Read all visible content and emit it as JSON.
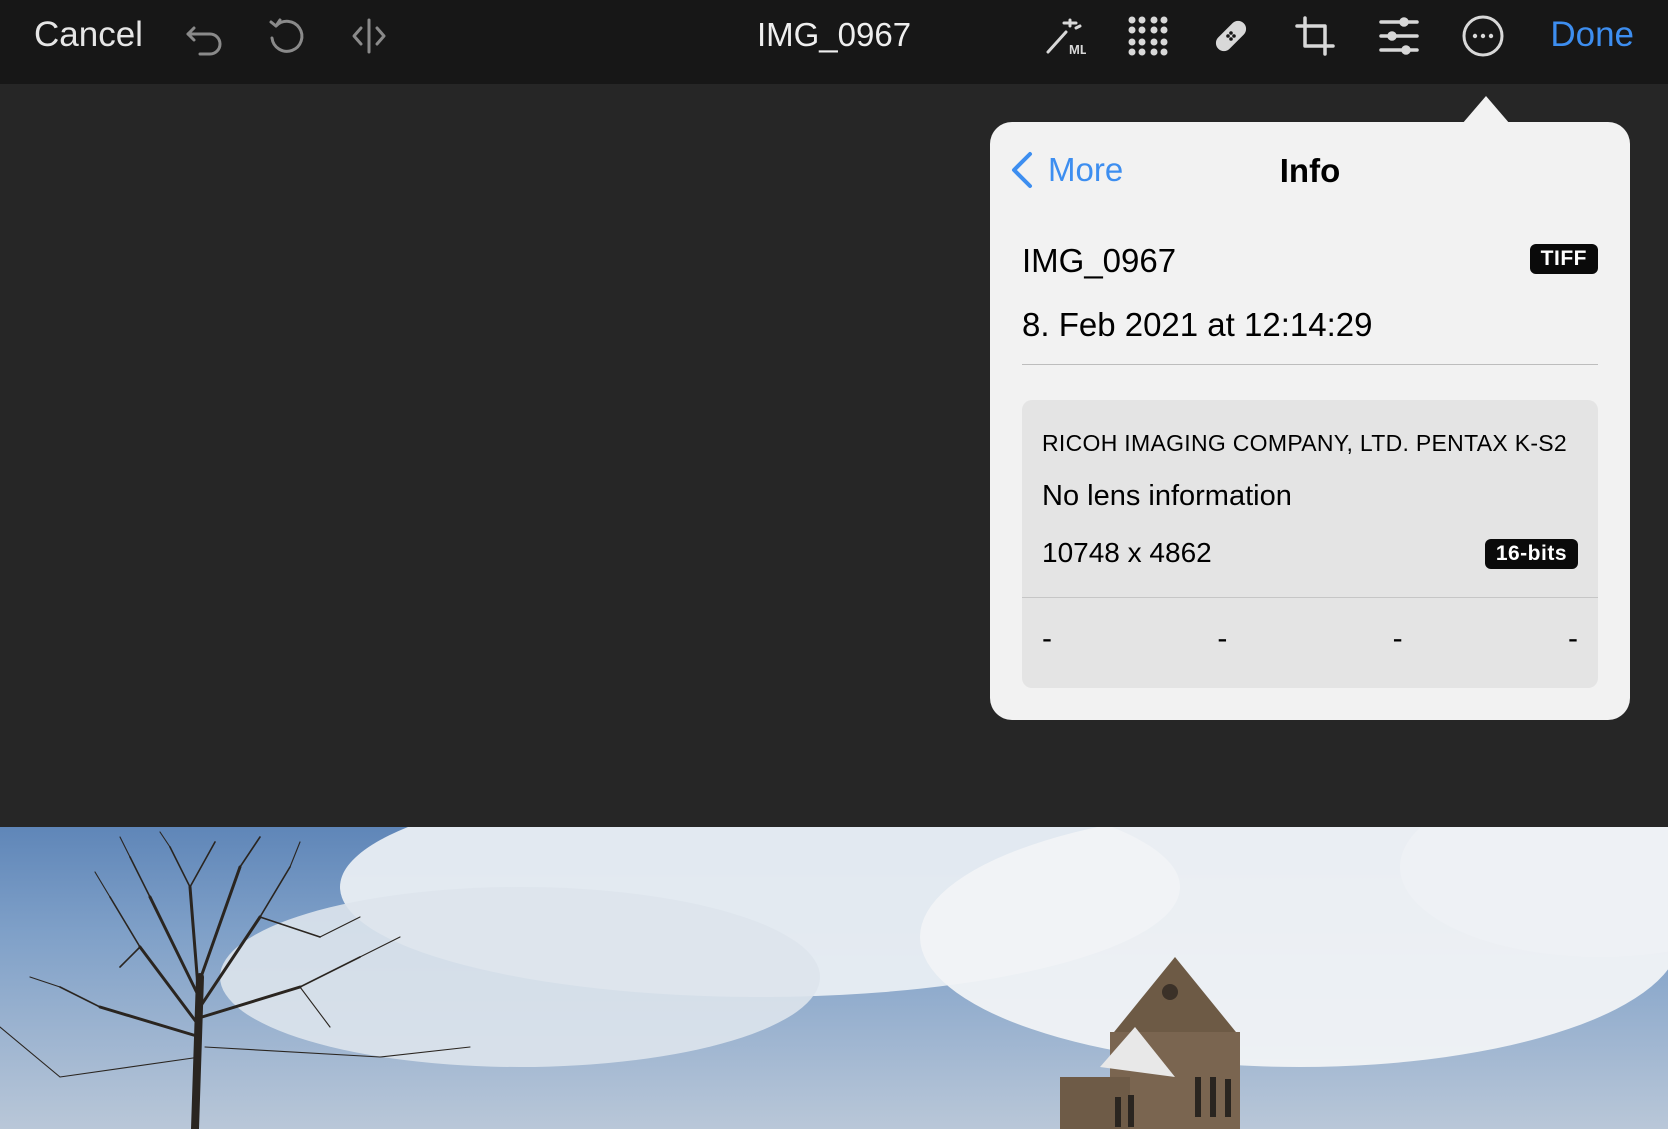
{
  "toolbar": {
    "cancel_label": "Cancel",
    "title": "IMG_0967",
    "done_label": "Done",
    "accent_color": "#3d8ef0",
    "icons": [
      "undo-icon",
      "revert-icon",
      "compare-icon",
      "ml-wand-icon",
      "grid-icon",
      "heal-bandage-icon",
      "crop-icon",
      "adjust-sliders-icon",
      "more-icon"
    ],
    "ml_label": "ML"
  },
  "info_popover": {
    "back_label": "More",
    "title": "Info",
    "file_name": "IMG_0967",
    "format_badge": "TIFF",
    "date": "8. Feb 2021 at 12:14:29",
    "camera": "RICOH IMAGING COMPANY, LTD. PENTAX K-S2",
    "lens": "No lens information",
    "dimensions": "10748 x 4862",
    "bit_depth_badge": "16-bits",
    "exif_values": [
      "-",
      "-",
      "-",
      "-"
    ]
  }
}
